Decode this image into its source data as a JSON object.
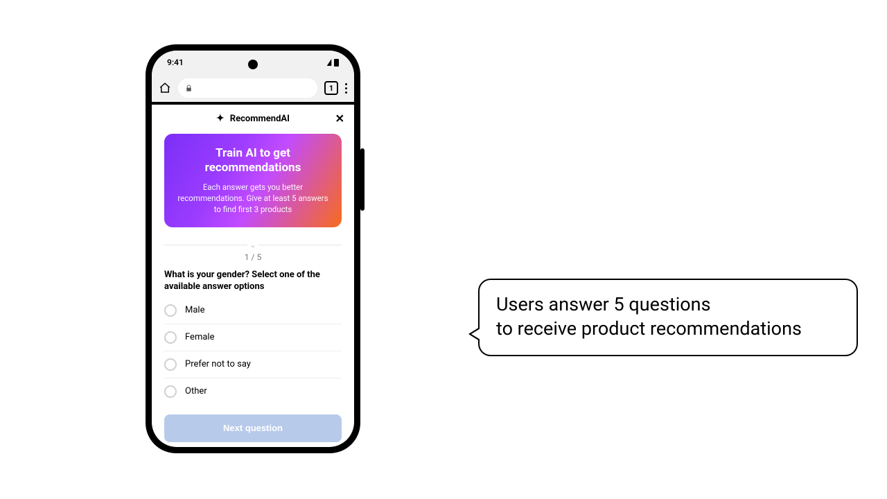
{
  "status": {
    "time": "9:41",
    "tab_count": "1"
  },
  "app": {
    "title": "RecommendAI",
    "hero_title": "Train AI to get recommendations",
    "hero_sub": "Each answer gets you better recommendations. Give at least 5 answers to find first 3 products",
    "progress": "1 / 5",
    "question": "What is your gender? Select one of the available answer options",
    "options": [
      "Male",
      "Female",
      "Prefer not to say",
      "Other"
    ],
    "next_label": "Next question"
  },
  "callout": {
    "line1": "Users answer 5 questions",
    "line2": "to receive product recommendations"
  }
}
